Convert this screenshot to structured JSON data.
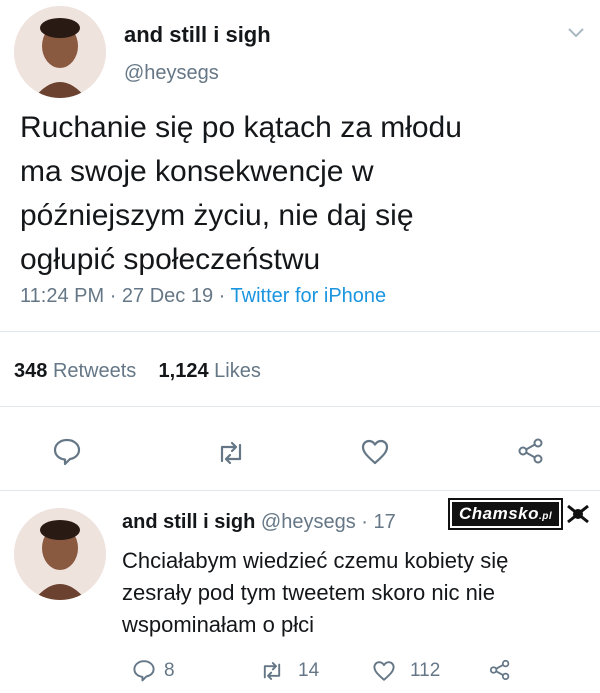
{
  "tweet": {
    "display_name": "and still i sigh",
    "handle": "@heysegs",
    "text_lines": [
      "Ruchanie się po kątach za młodu",
      "ma swoje konsekwencje w",
      "późniejszym życiu, nie daj się",
      "ogłupić społeczeństwu"
    ],
    "time": "11:24 PM",
    "date": "27 Dec 19",
    "source": "Twitter for iPhone",
    "sep": "·"
  },
  "stats": {
    "retweets_count": "348",
    "retweets_label": "Retweets",
    "likes_count": "1,124",
    "likes_label": "Likes"
  },
  "actions": [
    "reply-icon",
    "retweet-icon",
    "like-icon",
    "share-icon"
  ],
  "reply": {
    "display_name": "and still i sigh",
    "handle": "@heysegs",
    "time_partial": "· 17",
    "text_lines": [
      "Chciałabym wiedzieć czemu kobiety się",
      "zesrały pod tym tweetem skoro nic nie",
      "wspominałam o płci"
    ],
    "reply_count": "8",
    "retweet_count": "14",
    "like_count": "112"
  },
  "watermark": {
    "text": "Chamsko",
    "suffix": ".pl"
  },
  "colors": {
    "accent": "#1b95e0",
    "secondary_text": "#657786",
    "primary_text": "#14171a"
  }
}
